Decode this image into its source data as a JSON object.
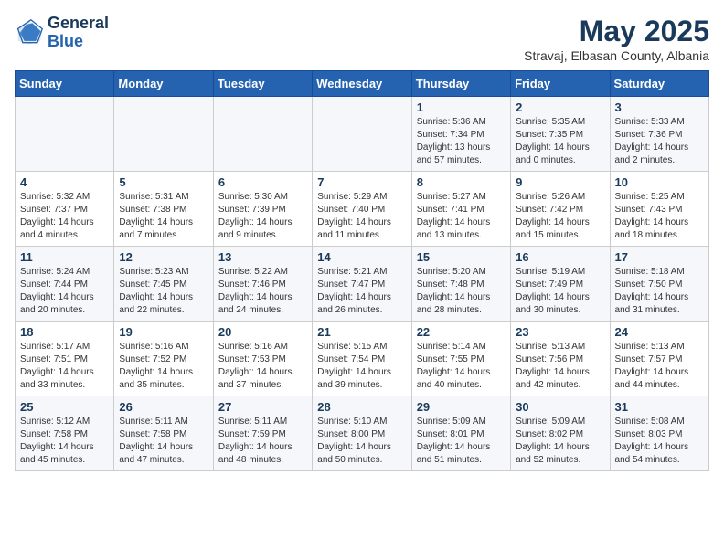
{
  "header": {
    "logo": {
      "line1": "General",
      "line2": "Blue"
    },
    "title": "May 2025",
    "subtitle": "Stravaj, Elbasan County, Albania"
  },
  "weekdays": [
    "Sunday",
    "Monday",
    "Tuesday",
    "Wednesday",
    "Thursday",
    "Friday",
    "Saturday"
  ],
  "weeks": [
    [
      {
        "day": "",
        "detail": ""
      },
      {
        "day": "",
        "detail": ""
      },
      {
        "day": "",
        "detail": ""
      },
      {
        "day": "",
        "detail": ""
      },
      {
        "day": "1",
        "detail": "Sunrise: 5:36 AM\nSunset: 7:34 PM\nDaylight: 13 hours\nand 57 minutes."
      },
      {
        "day": "2",
        "detail": "Sunrise: 5:35 AM\nSunset: 7:35 PM\nDaylight: 14 hours\nand 0 minutes."
      },
      {
        "day": "3",
        "detail": "Sunrise: 5:33 AM\nSunset: 7:36 PM\nDaylight: 14 hours\nand 2 minutes."
      }
    ],
    [
      {
        "day": "4",
        "detail": "Sunrise: 5:32 AM\nSunset: 7:37 PM\nDaylight: 14 hours\nand 4 minutes."
      },
      {
        "day": "5",
        "detail": "Sunrise: 5:31 AM\nSunset: 7:38 PM\nDaylight: 14 hours\nand 7 minutes."
      },
      {
        "day": "6",
        "detail": "Sunrise: 5:30 AM\nSunset: 7:39 PM\nDaylight: 14 hours\nand 9 minutes."
      },
      {
        "day": "7",
        "detail": "Sunrise: 5:29 AM\nSunset: 7:40 PM\nDaylight: 14 hours\nand 11 minutes."
      },
      {
        "day": "8",
        "detail": "Sunrise: 5:27 AM\nSunset: 7:41 PM\nDaylight: 14 hours\nand 13 minutes."
      },
      {
        "day": "9",
        "detail": "Sunrise: 5:26 AM\nSunset: 7:42 PM\nDaylight: 14 hours\nand 15 minutes."
      },
      {
        "day": "10",
        "detail": "Sunrise: 5:25 AM\nSunset: 7:43 PM\nDaylight: 14 hours\nand 18 minutes."
      }
    ],
    [
      {
        "day": "11",
        "detail": "Sunrise: 5:24 AM\nSunset: 7:44 PM\nDaylight: 14 hours\nand 20 minutes."
      },
      {
        "day": "12",
        "detail": "Sunrise: 5:23 AM\nSunset: 7:45 PM\nDaylight: 14 hours\nand 22 minutes."
      },
      {
        "day": "13",
        "detail": "Sunrise: 5:22 AM\nSunset: 7:46 PM\nDaylight: 14 hours\nand 24 minutes."
      },
      {
        "day": "14",
        "detail": "Sunrise: 5:21 AM\nSunset: 7:47 PM\nDaylight: 14 hours\nand 26 minutes."
      },
      {
        "day": "15",
        "detail": "Sunrise: 5:20 AM\nSunset: 7:48 PM\nDaylight: 14 hours\nand 28 minutes."
      },
      {
        "day": "16",
        "detail": "Sunrise: 5:19 AM\nSunset: 7:49 PM\nDaylight: 14 hours\nand 30 minutes."
      },
      {
        "day": "17",
        "detail": "Sunrise: 5:18 AM\nSunset: 7:50 PM\nDaylight: 14 hours\nand 31 minutes."
      }
    ],
    [
      {
        "day": "18",
        "detail": "Sunrise: 5:17 AM\nSunset: 7:51 PM\nDaylight: 14 hours\nand 33 minutes."
      },
      {
        "day": "19",
        "detail": "Sunrise: 5:16 AM\nSunset: 7:52 PM\nDaylight: 14 hours\nand 35 minutes."
      },
      {
        "day": "20",
        "detail": "Sunrise: 5:16 AM\nSunset: 7:53 PM\nDaylight: 14 hours\nand 37 minutes."
      },
      {
        "day": "21",
        "detail": "Sunrise: 5:15 AM\nSunset: 7:54 PM\nDaylight: 14 hours\nand 39 minutes."
      },
      {
        "day": "22",
        "detail": "Sunrise: 5:14 AM\nSunset: 7:55 PM\nDaylight: 14 hours\nand 40 minutes."
      },
      {
        "day": "23",
        "detail": "Sunrise: 5:13 AM\nSunset: 7:56 PM\nDaylight: 14 hours\nand 42 minutes."
      },
      {
        "day": "24",
        "detail": "Sunrise: 5:13 AM\nSunset: 7:57 PM\nDaylight: 14 hours\nand 44 minutes."
      }
    ],
    [
      {
        "day": "25",
        "detail": "Sunrise: 5:12 AM\nSunset: 7:58 PM\nDaylight: 14 hours\nand 45 minutes."
      },
      {
        "day": "26",
        "detail": "Sunrise: 5:11 AM\nSunset: 7:58 PM\nDaylight: 14 hours\nand 47 minutes."
      },
      {
        "day": "27",
        "detail": "Sunrise: 5:11 AM\nSunset: 7:59 PM\nDaylight: 14 hours\nand 48 minutes."
      },
      {
        "day": "28",
        "detail": "Sunrise: 5:10 AM\nSunset: 8:00 PM\nDaylight: 14 hours\nand 50 minutes."
      },
      {
        "day": "29",
        "detail": "Sunrise: 5:09 AM\nSunset: 8:01 PM\nDaylight: 14 hours\nand 51 minutes."
      },
      {
        "day": "30",
        "detail": "Sunrise: 5:09 AM\nSunset: 8:02 PM\nDaylight: 14 hours\nand 52 minutes."
      },
      {
        "day": "31",
        "detail": "Sunrise: 5:08 AM\nSunset: 8:03 PM\nDaylight: 14 hours\nand 54 minutes."
      }
    ]
  ]
}
